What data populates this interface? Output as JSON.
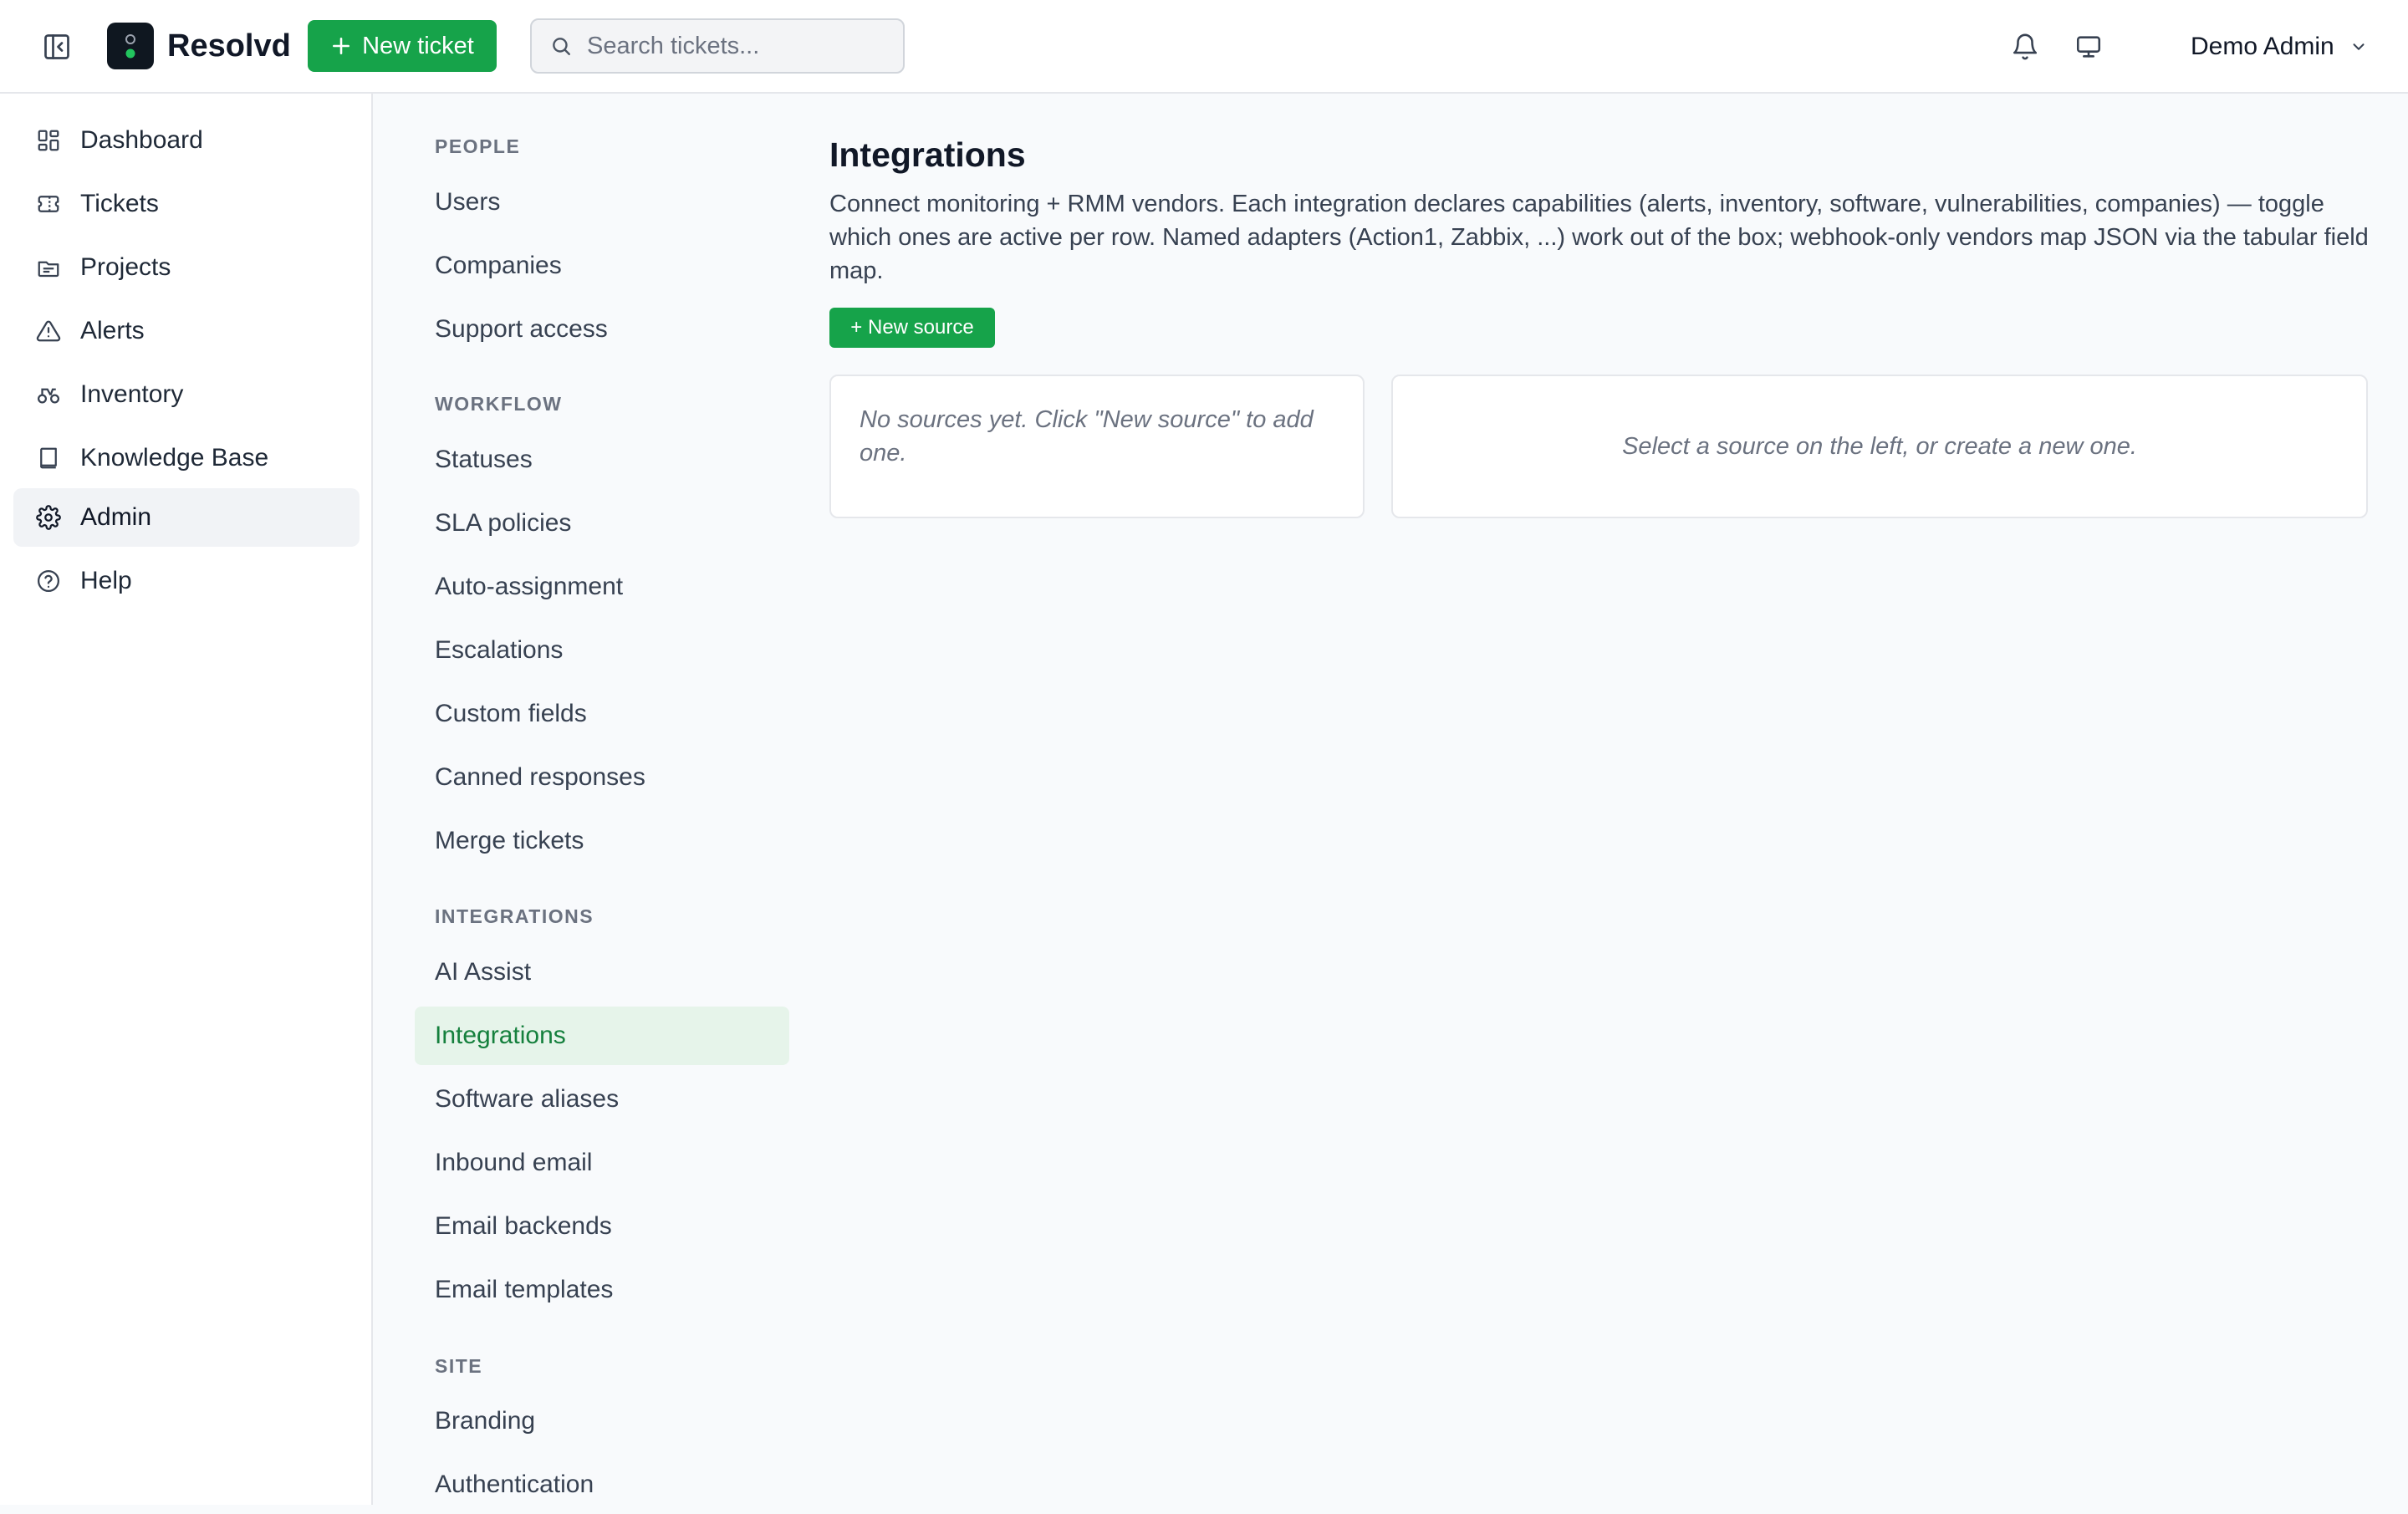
{
  "app": {
    "brand": "Resolvd",
    "new_ticket_label": "New ticket",
    "search_placeholder": "Search tickets...",
    "user_name": "Demo Admin"
  },
  "colors": {
    "accent": "#16a34a",
    "accent_soft": "#e6f4ea",
    "logo_bg": "#0f1720"
  },
  "sidebar": {
    "items": [
      {
        "label": "Dashboard",
        "icon": "dashboard-icon"
      },
      {
        "label": "Tickets",
        "icon": "ticket-icon"
      },
      {
        "label": "Projects",
        "icon": "projects-icon"
      },
      {
        "label": "Alerts",
        "icon": "alert-triangle-icon"
      },
      {
        "label": "Inventory",
        "icon": "inventory-icon"
      },
      {
        "label": "Knowledge Base",
        "icon": "book-icon"
      },
      {
        "label": "Admin",
        "icon": "gear-icon",
        "active": true
      },
      {
        "label": "Help",
        "icon": "help-circle-icon"
      }
    ]
  },
  "admin_nav": {
    "sections": [
      {
        "label": "PEOPLE",
        "items": [
          "Users",
          "Companies",
          "Support access"
        ]
      },
      {
        "label": "WORKFLOW",
        "items": [
          "Statuses",
          "SLA policies",
          "Auto-assignment",
          "Escalations",
          "Custom fields",
          "Canned responses",
          "Merge tickets"
        ]
      },
      {
        "label": "INTEGRATIONS",
        "items": [
          "AI Assist",
          "Integrations",
          "Software aliases",
          "Inbound email",
          "Email backends",
          "Email templates"
        ]
      },
      {
        "label": "SITE",
        "items": [
          "Branding",
          "Authentication"
        ]
      }
    ],
    "active_item": "Integrations"
  },
  "main": {
    "title": "Integrations",
    "description": "Connect monitoring + RMM vendors. Each integration declares capabilities (alerts, inventory, software, vulnerabilities, companies) — toggle which ones are active per row. Named adapters (Action1, Zabbix, ...) work out of the box; webhook-only vendors map JSON via the tabular field map.",
    "new_source_label": "+ New source",
    "empty_sources": "No sources yet. Click \"New source\" to add one.",
    "empty_detail": "Select a source on the left, or create a new one."
  }
}
